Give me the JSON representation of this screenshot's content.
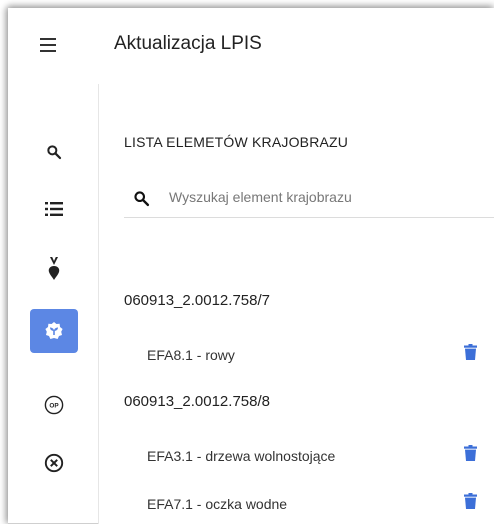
{
  "header": {
    "title": "Aktualizacja LPIS",
    "menu_icon": "hamburger-menu-icon"
  },
  "sidebar": {
    "items": [
      {
        "icon": "search-icon",
        "active": false
      },
      {
        "icon": "list-icon",
        "active": false
      },
      {
        "icon": "beetroot-icon",
        "active": false
      },
      {
        "icon": "plant-badge-icon",
        "active": true
      },
      {
        "icon": "op-badge-icon",
        "active": false,
        "badge_text": "OP"
      },
      {
        "icon": "close-circle-icon",
        "active": false
      }
    ],
    "active_color": "#5c87e4"
  },
  "main": {
    "section_title": "LISTA ELEMETÓW KRAJOBRAZU",
    "search": {
      "placeholder": "Wyszukaj element krajobrazu",
      "value": ""
    },
    "groups": [
      {
        "id": "060913_2.0012.758/7",
        "items": [
          {
            "label": "EFA8.1 - rowy"
          }
        ]
      },
      {
        "id": "060913_2.0012.758/8",
        "items": [
          {
            "label": "EFA3.1 - drzewa wolnostojące"
          },
          {
            "label": "EFA7.1 - oczka wodne"
          }
        ]
      }
    ],
    "delete_icon": "trash-icon",
    "accent_color": "#3c6fd8"
  }
}
